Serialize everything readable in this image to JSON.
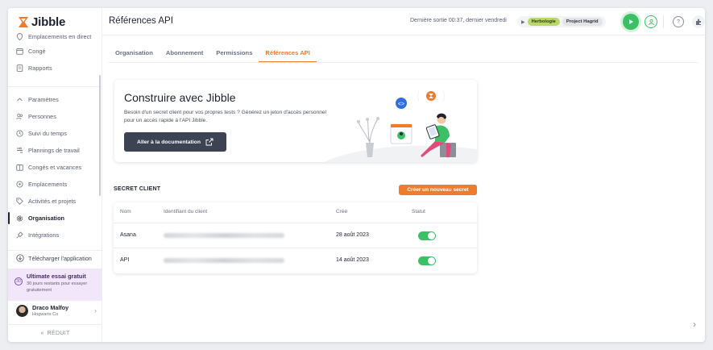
{
  "app": {
    "name": "Jibble"
  },
  "sidebar": {
    "items": [
      {
        "label": "Emplacements en direct",
        "icon": "location-icon"
      },
      {
        "label": "Congé",
        "icon": "calendar-icon"
      },
      {
        "label": "Rapports",
        "icon": "report-icon"
      },
      {
        "label": "Paramètres",
        "icon": "chevron-up-icon"
      },
      {
        "label": "Personnes",
        "icon": "people-icon"
      },
      {
        "label": "Suivi du temps",
        "icon": "clock-icon"
      },
      {
        "label": "Plannings de travail",
        "icon": "schedule-icon"
      },
      {
        "label": "Congés et vacances",
        "icon": "vacation-icon"
      },
      {
        "label": "Emplacements",
        "icon": "pin-icon"
      },
      {
        "label": "Activités et projets",
        "icon": "tag-icon"
      },
      {
        "label": "Organisation",
        "icon": "gear-icon",
        "active": true
      },
      {
        "label": "Intégrations",
        "icon": "plug-icon"
      }
    ],
    "download_label": "Télécharger l'application",
    "trial": {
      "badge": "30",
      "title": "Ultimate essai gratuit",
      "subtitle": "30 jours restants pour essayer gratuitement"
    },
    "user": {
      "name": "Draco Malfoy",
      "org": "Hogwarts Co"
    },
    "collapse_label": "RÉDUIT"
  },
  "header": {
    "title": "Références API",
    "last_out": "Dernière sortie 00:37, dernier vendredi",
    "activity_tag": "Herbologie",
    "project_tag": "Project Hagrid"
  },
  "tabs": [
    {
      "label": "Organisation",
      "active": false
    },
    {
      "label": "Abonnement",
      "active": false
    },
    {
      "label": "Permissions",
      "active": false
    },
    {
      "label": "Références API",
      "active": true
    }
  ],
  "banner": {
    "title": "Construire avec Jibble",
    "text": "Besoin d'un secret client pour vos propres tests ? Générez un jeton d'accès personnel pour un accès rapide à l'API Jibble.",
    "button_label": "Aller à la documentation"
  },
  "secret_client": {
    "title": "SECRET CLIENT",
    "new_button": "Créer un nouveau secret",
    "columns": [
      "Nom",
      "Identifiant du client",
      "Créé",
      "Statut"
    ],
    "rows": [
      {
        "name": "Asana",
        "created": "28 août 2023",
        "status_on": true
      },
      {
        "name": "API",
        "created": "14 août 2023",
        "status_on": true
      }
    ]
  },
  "colors": {
    "accent": "#f07b2a",
    "success": "#3cc066",
    "dark_button": "#3c4353"
  }
}
